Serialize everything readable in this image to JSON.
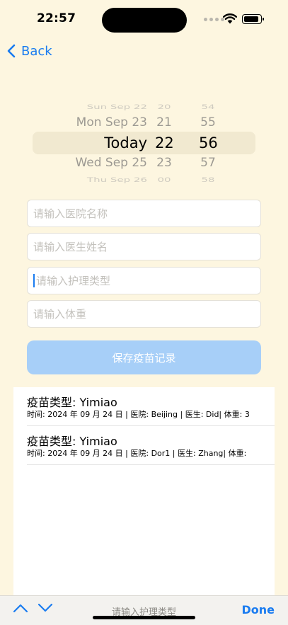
{
  "status": {
    "time": "22:57"
  },
  "nav": {
    "back_label": "Back"
  },
  "picker": {
    "rows": [
      {
        "day": "Sun Sep 22",
        "hour": "20",
        "minute": "54"
      },
      {
        "day": "Mon Sep 23",
        "hour": "21",
        "minute": "55"
      },
      {
        "day": "Today",
        "hour": "22",
        "minute": "56"
      },
      {
        "day": "Wed Sep 25",
        "hour": "23",
        "minute": "57"
      },
      {
        "day": "Thu Sep 26",
        "hour": "00",
        "minute": "58"
      }
    ]
  },
  "form": {
    "hospital_placeholder": "请输入医院名称",
    "doctor_placeholder": "请输入医生姓名",
    "care_type_placeholder": "请输入护理类型",
    "weight_placeholder": "请输入体重",
    "save_label": "保存疫苗记录"
  },
  "records": [
    {
      "title": "疫苗类型: Yimiao",
      "detail": "时间: 2024 年 09 月 24 日 | 医院: Beijing | 医生: Did| 体重: 3"
    },
    {
      "title": "疫苗类型: Yimiao",
      "detail": "时间: 2024 年 09 月 24 日 | 医院: Dor1 | 医生: Zhang| 体重:"
    }
  ],
  "toolbar": {
    "field_label": "请输入护理类型",
    "done_label": "Done"
  },
  "colors": {
    "accent": "#1a7cf0",
    "background": "#fdf6e0",
    "button_disabled": "#a7cff8"
  }
}
